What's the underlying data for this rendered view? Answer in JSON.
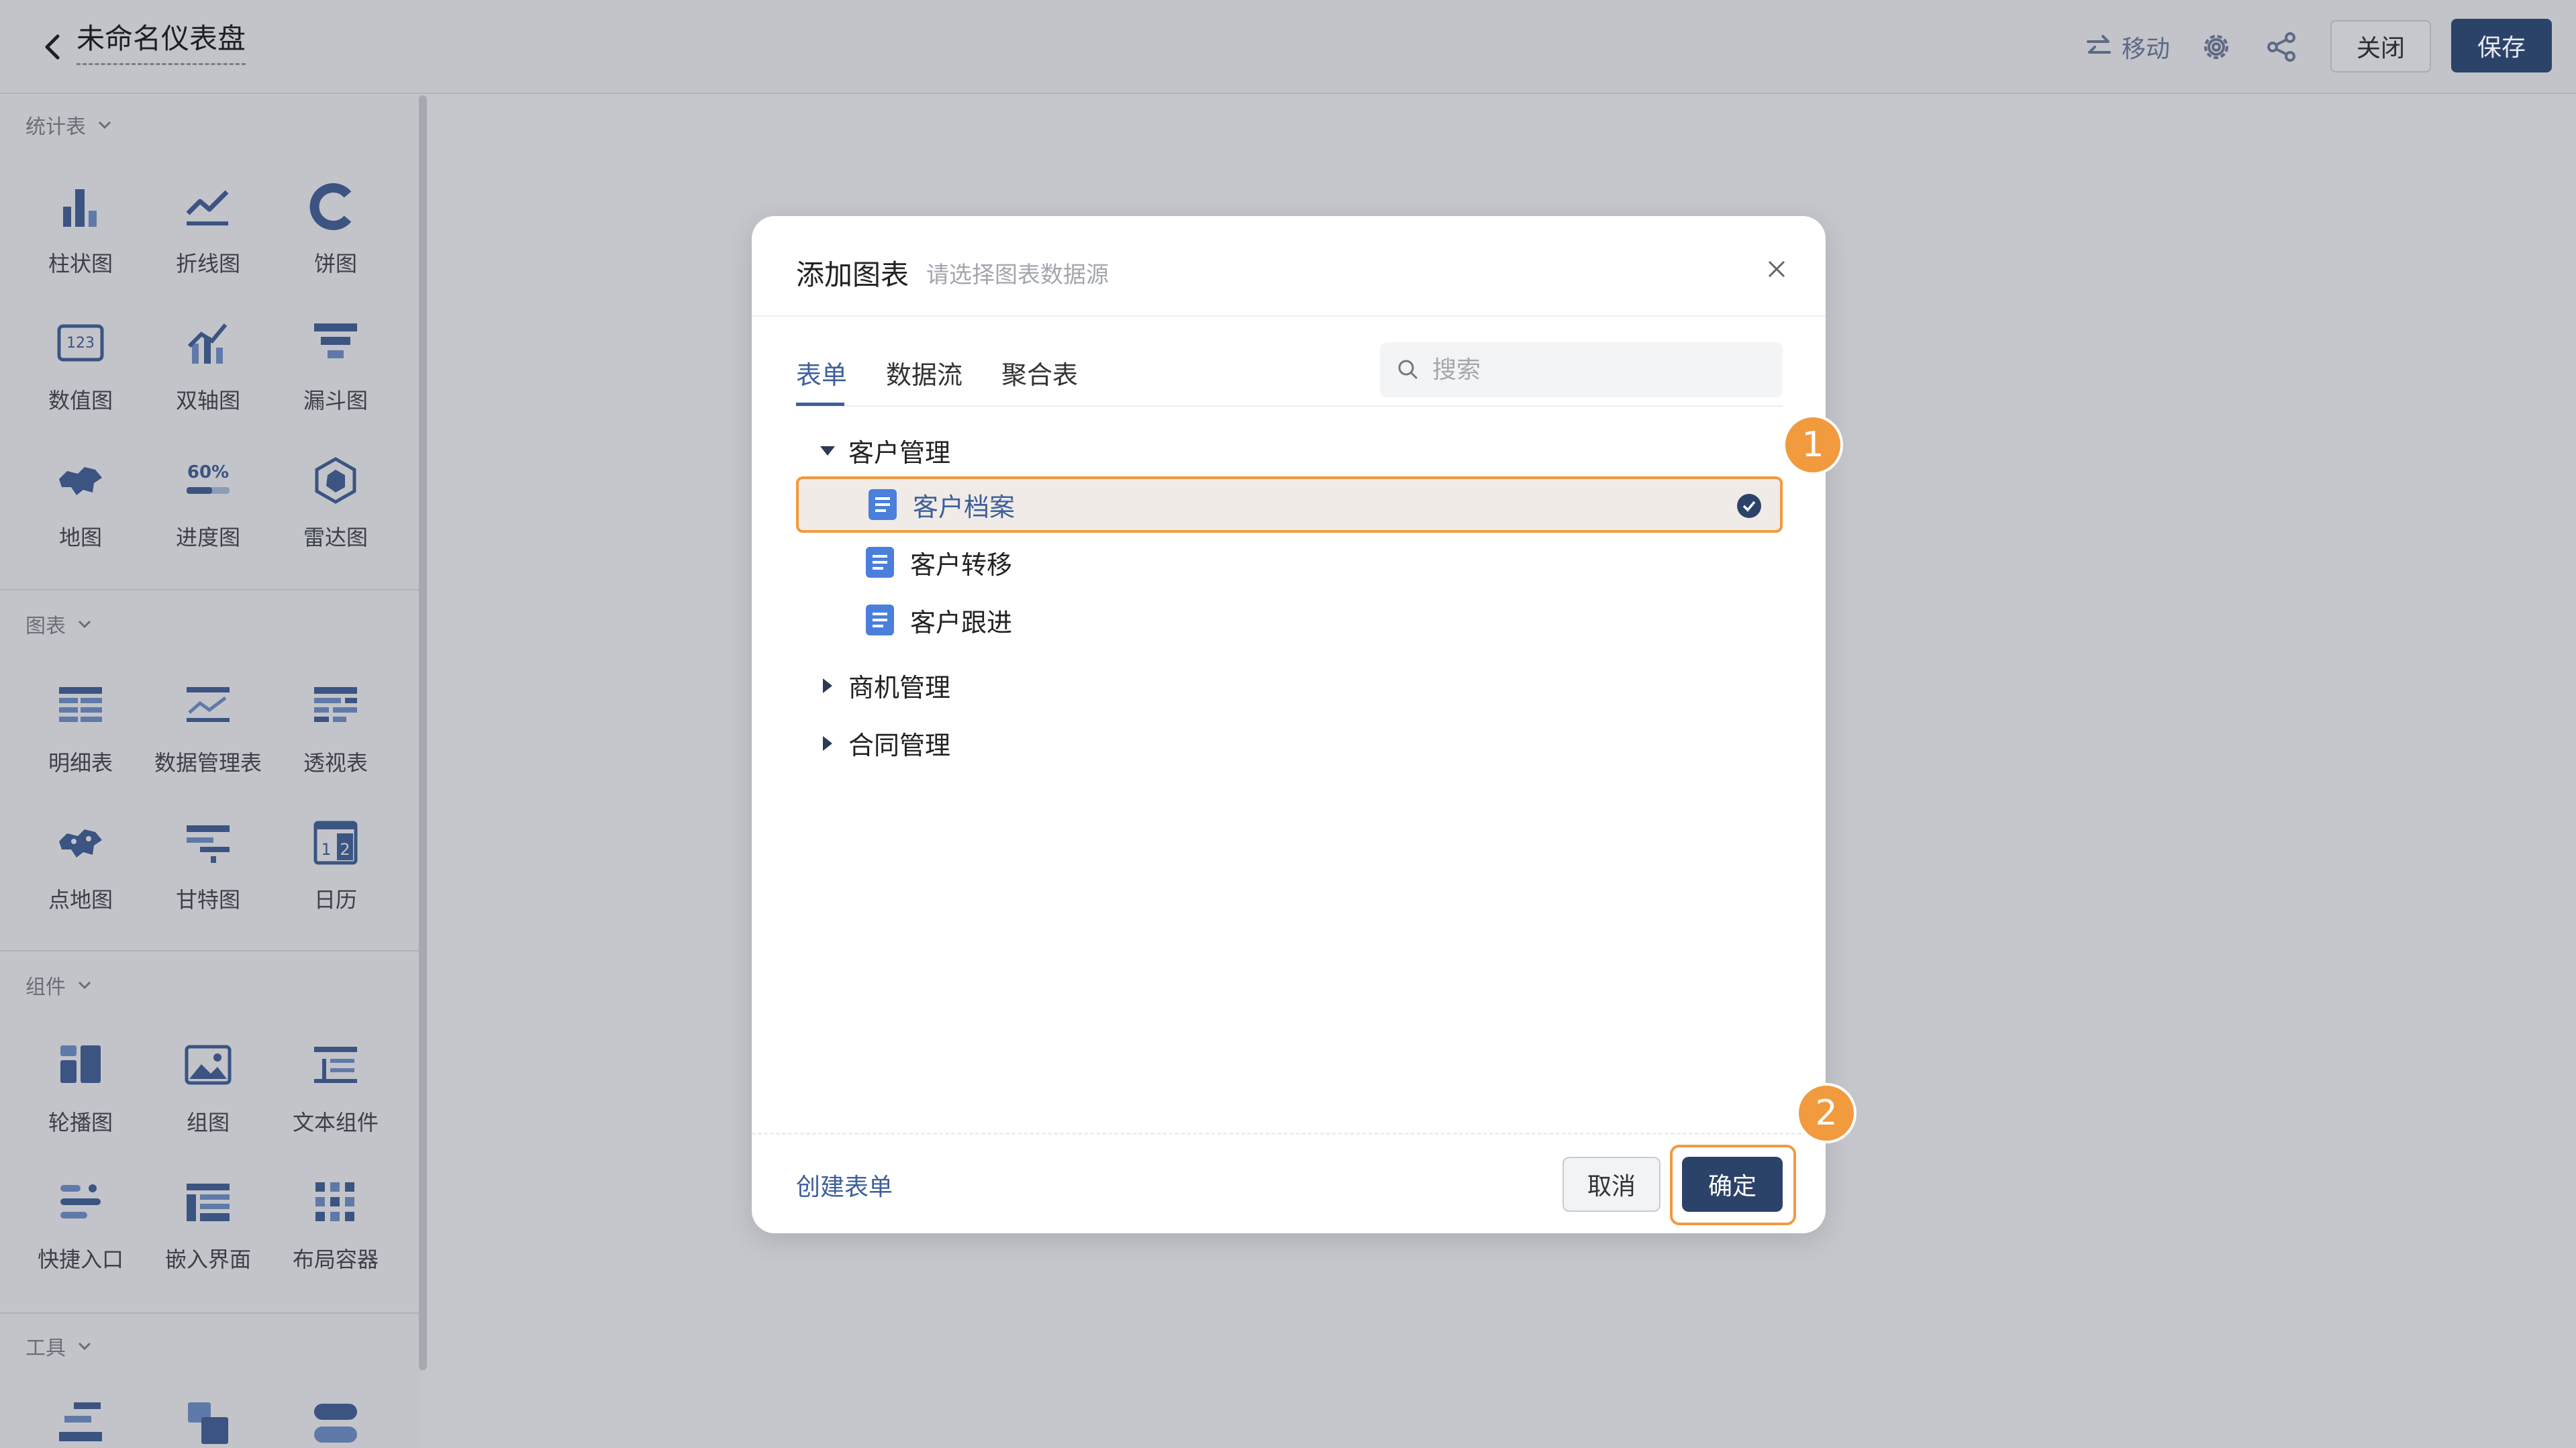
{
  "header": {
    "title": "未命名仪表盘",
    "move_label": "移动",
    "close_label": "关闭",
    "save_label": "保存"
  },
  "sidebar": {
    "sections": [
      {
        "title": "统计表",
        "items": [
          "柱状图",
          "折线图",
          "饼图",
          "数值图",
          "双轴图",
          "漏斗图",
          "地图",
          "进度图",
          "雷达图"
        ]
      },
      {
        "title": "图表",
        "items": [
          "明细表",
          "数据管理表",
          "透视表",
          "点地图",
          "甘特图",
          "日历"
        ]
      },
      {
        "title": "组件",
        "items": [
          "轮播图",
          "组图",
          "文本组件",
          "快捷入口",
          "嵌入界面",
          "布局容器"
        ]
      },
      {
        "title": "工具",
        "items": []
      }
    ],
    "icon_texts": {
      "number": "123",
      "progress": "60%",
      "calendar_a": "1",
      "calendar_b": "2"
    }
  },
  "dialog": {
    "title": "添加图表",
    "subtitle": "请选择图表数据源",
    "tabs": [
      "表单",
      "数据流",
      "聚合表"
    ],
    "active_tab": "表单",
    "search_placeholder": "搜索",
    "tree": {
      "groups": [
        {
          "label": "客户管理",
          "expanded": true,
          "items": [
            "客户档案",
            "客户转移",
            "客户跟进"
          ],
          "selected": "客户档案"
        },
        {
          "label": "商机管理",
          "expanded": false
        },
        {
          "label": "合同管理",
          "expanded": false
        }
      ]
    },
    "create_form_label": "创建表单",
    "cancel_label": "取消",
    "ok_label": "确定"
  },
  "steps": [
    "1",
    "2"
  ],
  "colors": {
    "accent": "#2c4369",
    "link": "#3e5f9a",
    "highlight": "#f19a3e",
    "doc_icon": "#4a7fdc"
  }
}
